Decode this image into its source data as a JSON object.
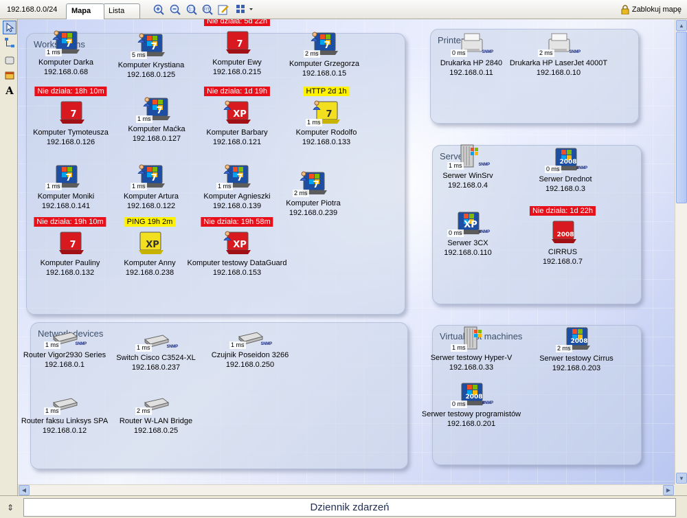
{
  "toolbar": {
    "network": "192.168.0.0/24",
    "tabs": [
      {
        "label": "Mapa"
      },
      {
        "label": "Lista"
      }
    ],
    "lock_label": "Zablokuj mapę"
  },
  "groups": {
    "workstations": {
      "title": "Workstations",
      "nodes": [
        {
          "name": "Komputer Darka",
          "ip": "192.168.0.68",
          "ms": "1 ms",
          "os": "win7",
          "user": true,
          "state": "ok"
        },
        {
          "name": "Komputer Krystiana",
          "ip": "192.168.0.125",
          "ms": "5 ms",
          "os": "win7",
          "user": true,
          "state": "ok"
        },
        {
          "name": "Komputer Ewy",
          "ip": "192.168.0.215",
          "ms": "",
          "os": "win7",
          "user": false,
          "state": "down",
          "alert": "Nie działa: 5d 22h"
        },
        {
          "name": "Komputer Grzegorza",
          "ip": "192.168.0.15",
          "ms": "2 ms",
          "os": "win7",
          "user": true,
          "state": "ok"
        },
        {
          "name": "Komputer Tymoteusza",
          "ip": "192.168.0.126",
          "ms": "",
          "os": "win7",
          "user": false,
          "state": "down",
          "alert": "Nie działa: 18h 10m"
        },
        {
          "name": "Komputer Maćka",
          "ip": "192.168.0.127",
          "ms": "1 ms",
          "os": "win7",
          "user": true,
          "state": "ok"
        },
        {
          "name": "Komputer Barbary",
          "ip": "192.168.0.121",
          "ms": "",
          "os": "xp",
          "user": true,
          "state": "down",
          "alert": "Nie działa: 1d 19h"
        },
        {
          "name": "Komputer Rodolfo",
          "ip": "192.168.0.133",
          "ms": "1 ms",
          "os": "win7",
          "user": true,
          "state": "warn",
          "alert": "HTTP 2d 1h"
        },
        {
          "name": "Komputer Moniki",
          "ip": "192.168.0.141",
          "ms": "1 ms",
          "os": "win7",
          "user": false,
          "state": "ok"
        },
        {
          "name": "Komputer Artura",
          "ip": "192.168.0.122",
          "ms": "1 ms",
          "os": "win7",
          "user": true,
          "state": "ok"
        },
        {
          "name": "Komputer Agnieszki",
          "ip": "192.168.0.139",
          "ms": "1 ms",
          "os": "win7",
          "user": true,
          "state": "ok"
        },
        {
          "name": "Komputer Piotra",
          "ip": "192.168.0.239",
          "ms": "2 ms",
          "os": "win7",
          "user": true,
          "state": "ok"
        },
        {
          "name": "Komputer Pauliny",
          "ip": "192.168.0.132",
          "ms": "",
          "os": "win7",
          "user": false,
          "state": "down",
          "alert": "Nie działa: 19h 10m"
        },
        {
          "name": "Komputer Anny",
          "ip": "192.168.0.238",
          "ms": "",
          "os": "xp",
          "user": false,
          "state": "warn",
          "alert": "PING 19h 2m"
        },
        {
          "name": "Komputer testowy DataGuard",
          "ip": "192.168.0.153",
          "ms": "",
          "os": "xp",
          "user": true,
          "state": "down",
          "alert": "Nie działa: 19h 58m"
        }
      ]
    },
    "printers": {
      "title": "Printers",
      "nodes": [
        {
          "name": "Drukarka HP 2840",
          "ip": "192.168.0.11",
          "ms": "0 ms",
          "snmp": "SNMP"
        },
        {
          "name": "Drukarka HP LaserJet 4000T",
          "ip": "192.168.0.10",
          "ms": "2 ms",
          "snmp": "SNMP"
        }
      ]
    },
    "servers": {
      "title": "Servers",
      "nodes": [
        {
          "name": "Serwer WinSrv",
          "ip": "192.168.0.4",
          "ms": "1 ms",
          "os": "server",
          "snmp": "SNMP",
          "state": "ok"
        },
        {
          "name": "Serwer Drednot",
          "ip": "192.168.0.3",
          "ms": "0 ms",
          "os": "2008",
          "snmp": "SNMP",
          "state": "ok"
        },
        {
          "name": "Serwer 3CX",
          "ip": "192.168.0.110",
          "ms": "0 ms",
          "os": "xp",
          "snmp": "SNMP",
          "state": "ok"
        },
        {
          "name": "CIRRUS",
          "ip": "192.168.0.7",
          "ms": "",
          "os": "2008",
          "snmp": "",
          "state": "down",
          "alert": "Nie działa: 1d 22h"
        }
      ]
    },
    "network": {
      "title": "Network devices",
      "nodes": [
        {
          "name": "Router Vigor2930 Series",
          "ip": "192.168.0.1",
          "ms": "1 ms",
          "snmp": "SNMP"
        },
        {
          "name": "Switch Cisco C3524-XL",
          "ip": "192.168.0.237",
          "ms": "1 ms",
          "snmp": "SNMP"
        },
        {
          "name": "Czujnik Poseidon 3266",
          "ip": "192.168.0.250",
          "ms": "1 ms",
          "snmp": "SNMP"
        },
        {
          "name": "Router faksu Linksys SPA",
          "ip": "192.168.0.12",
          "ms": "1 ms",
          "snmp": ""
        },
        {
          "name": "Router W-LAN Bridge",
          "ip": "192.168.0.25",
          "ms": "2 ms",
          "snmp": ""
        }
      ]
    },
    "virtual": {
      "title": "Virtual test machines",
      "nodes": [
        {
          "name": "Serwer testowy Hyper-V",
          "ip": "192.168.0.33",
          "ms": "1 ms",
          "os": "server",
          "snmp": ""
        },
        {
          "name": "Serwer testowy Cirrus",
          "ip": "192.168.0.203",
          "ms": "2 ms",
          "os": "2008",
          "snmp": ""
        },
        {
          "name": "Serwer testowy programistów",
          "ip": "192.168.0.201",
          "ms": "0 ms",
          "os": "2008",
          "snmp": "SNMP"
        }
      ]
    }
  },
  "event_log": {
    "title": "Dziennik zdarzeń"
  },
  "colors": {
    "down": "#e8101a",
    "warn": "#fff200",
    "ok_screen": "#1c4fa3"
  }
}
